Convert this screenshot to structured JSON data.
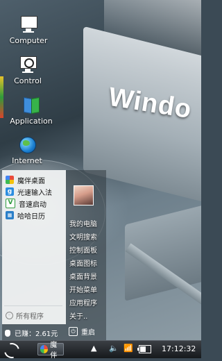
{
  "wallpaper": {
    "logo_text": "Windo"
  },
  "desktop_icons": [
    {
      "label": "Computer"
    },
    {
      "label": "Control"
    },
    {
      "label": "Application"
    },
    {
      "label": "Internet"
    }
  ],
  "start_menu": {
    "programs": [
      {
        "label": "魔伴桌面",
        "icon": "moban-icon"
      },
      {
        "label": "光速输入法",
        "icon": "input-method-icon"
      },
      {
        "label": "音速启动",
        "icon": "speed-launch-icon"
      },
      {
        "label": "哈哈日历",
        "icon": "calendar-icon"
      }
    ],
    "all_programs": "所有程序",
    "earned": "已赚：2.61元",
    "right_items": [
      {
        "label": "我的电脑"
      },
      {
        "label": "文明搜索"
      },
      {
        "label": "控制面板"
      },
      {
        "label": "桌面图标"
      },
      {
        "label": "桌面背景"
      },
      {
        "label": "开始菜单"
      },
      {
        "label": "应用程序"
      },
      {
        "label": "关于.."
      }
    ],
    "restart": "重启"
  },
  "taskbar": {
    "task_label": "魔伴",
    "clock": "17:12:32",
    "battery_level": 0.55,
    "tray_icons": [
      "up-arrow-icon",
      "volume-icon",
      "wifi-icon",
      "battery-icon"
    ]
  }
}
